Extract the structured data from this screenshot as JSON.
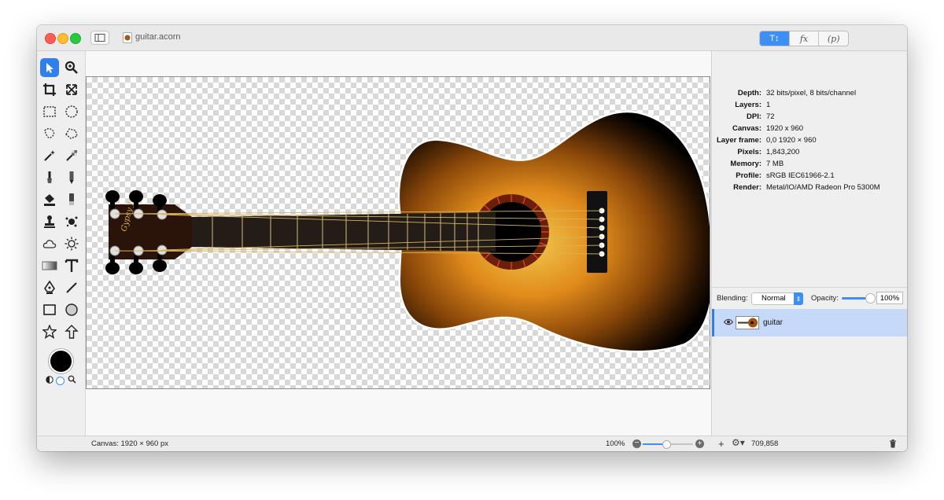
{
  "window": {
    "document_title": "guitar.acorn"
  },
  "header": {
    "segments": [
      {
        "label": "T↕",
        "icon": "text-tools-icon"
      },
      {
        "label": "fx",
        "icon": "effects-icon"
      },
      {
        "label": "(p)",
        "icon": "properties-icon"
      }
    ]
  },
  "toolbox": {
    "tools": [
      "move-tool",
      "zoom-tool",
      "crop-tool",
      "transform-tool",
      "rect-select-tool",
      "ellipse-select-tool",
      "lasso-tool",
      "polygon-lasso-tool",
      "magic-wand-tool",
      "instant-alpha-tool",
      "brush-tool",
      "pencil-tool",
      "paint-bucket-tool",
      "eraser-tool",
      "clone-tool",
      "splatter-tool",
      "cloud-tool",
      "brightness-tool",
      "gradient-tool",
      "text-tool",
      "pen-tool",
      "line-tool",
      "rectangle-tool",
      "oval-tool",
      "star-tool",
      "arrow-tool"
    ],
    "foreground_color": "#000000"
  },
  "inspector": {
    "info": [
      {
        "key": "Depth:",
        "value": "32 bits/pixel, 8 bits/channel"
      },
      {
        "key": "Layers:",
        "value": "1"
      },
      {
        "key": "DPI:",
        "value": "72"
      },
      {
        "key": "Canvas:",
        "value": "1920 x 960"
      },
      {
        "key": "Layer frame:",
        "value": "0,0 1920 × 960"
      },
      {
        "key": "Pixels:",
        "value": "1,843,200"
      },
      {
        "key": "Memory:",
        "value": "7 MB"
      },
      {
        "key": "Profile:",
        "value": "sRGB IEC61966-2.1"
      },
      {
        "key": "Render:",
        "value": "Metal/IO/AMD Radeon Pro 5300M"
      }
    ],
    "blending_label": "Blending:",
    "blending_value": "Normal",
    "opacity_label": "Opacity:",
    "opacity_value": "100%",
    "layers": [
      {
        "name": "guitar",
        "visible": true
      }
    ]
  },
  "canvas": {
    "headstock_text": "Gypsy Jazz"
  },
  "statusbar": {
    "canvas_size": "Canvas: 1920 × 960 px",
    "zoom": "100%",
    "zoom_minus": "−",
    "zoom_plus": "+",
    "add_label": "+",
    "gear_label": "⚙▾",
    "count": "709,858"
  },
  "colors": {
    "accent": "#2f80ee",
    "selected_layer": "#c7d9f8"
  }
}
